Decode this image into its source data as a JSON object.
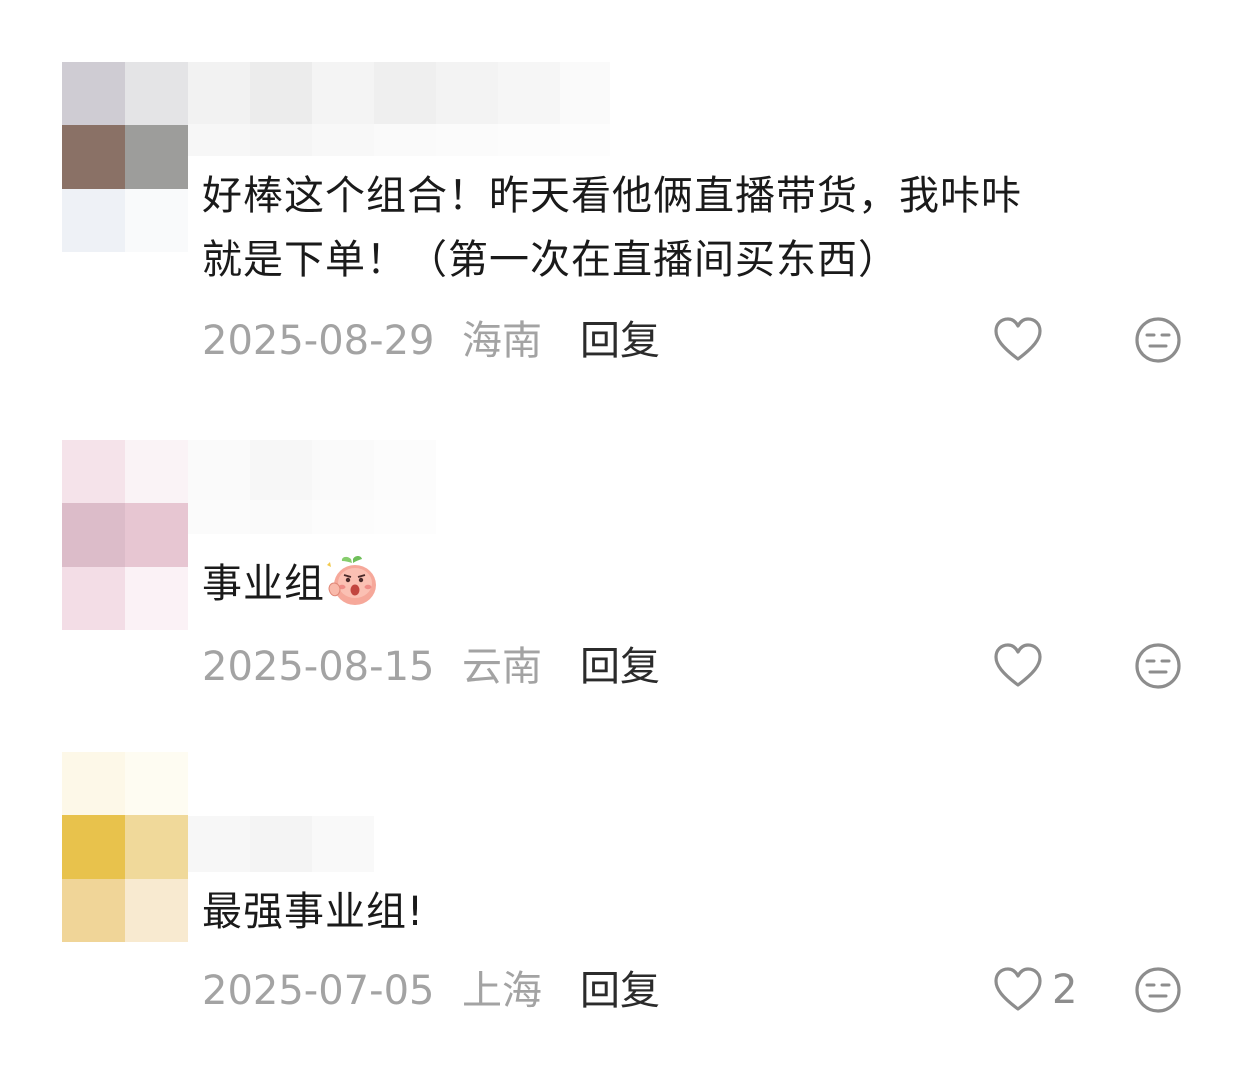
{
  "colors": {
    "text_primary": "#1a1a1a",
    "meta_gray": "#a3a3a3",
    "icon_gray": "#8d8d8d",
    "background": "#ffffff"
  },
  "comments": [
    {
      "text_line1": "好棒这个组合！昨天看他俩直播带货，我咔咔",
      "text_line2": "就是下单！（第一次在直播间买东西）",
      "date": "2025-08-29",
      "location": "海南",
      "reply_label": "回复",
      "like_count": "",
      "like_icon": "heart-outline-icon",
      "dislike_icon": "meh-face-icon"
    },
    {
      "text": "事业组",
      "emoji_icon": "peach-cheer-emoji-icon",
      "date": "2025-08-15",
      "location": "云南",
      "reply_label": "回复",
      "like_count": "",
      "like_icon": "heart-outline-icon",
      "dislike_icon": "meh-face-icon"
    },
    {
      "text": "最强事业组!",
      "date": "2025-07-05",
      "location": "上海",
      "reply_label": "回复",
      "like_count": "2",
      "like_icon": "heart-outline-icon",
      "dislike_icon": "meh-face-icon"
    }
  ]
}
